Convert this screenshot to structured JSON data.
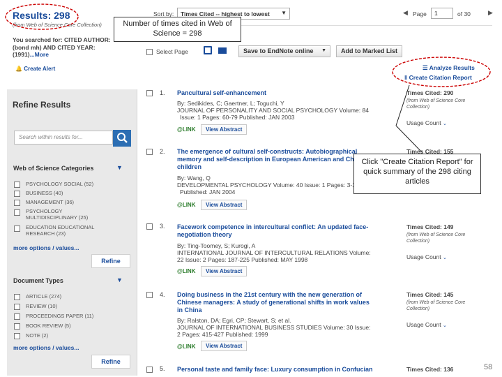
{
  "header": {
    "results_title": "Results: 298",
    "results_source": "(from Web of Science Core Collection)",
    "searched_for": "You searched for: CITED AUTHOR: (bond mh) AND CITED YEAR: (1991)",
    "more_link": "...More",
    "create_alert": "Create Alert"
  },
  "toolbar": {
    "sort_label": "Sort by:",
    "sort_value": "Times Cited -- highest to lowest",
    "page_label": "Page",
    "page_value": "1",
    "page_total": "of 30",
    "select_page": "Select Page",
    "save_endnote": "Save to EndNote online",
    "add_marked": "Add to Marked List",
    "analyze_results": "Analyze Results",
    "create_citation_report": "Create Citation Report"
  },
  "sidebar": {
    "refine_title": "Refine Results",
    "search_placeholder": "Search within results for...",
    "wos_categories_title": "Web of Science Categories",
    "categories": [
      "PSYCHOLOGY SOCIAL (52)",
      "BUSINESS (40)",
      "MANAGEMENT (36)",
      "PSYCHOLOGY MULTIDISCIPLINARY (25)",
      "EDUCATION EDUCATIONAL RESEARCH (23)"
    ],
    "more_options_1": "more options / values...",
    "refine_button_1": "Refine",
    "document_types_title": "Document Types",
    "doc_types": [
      "ARTICLE (274)",
      "REVIEW (10)",
      "PROCEEDINGS PAPER (11)",
      "BOOK REVIEW (5)",
      "NOTE (2)"
    ],
    "more_options_2": "more options / values...",
    "refine_button_2": "Refine"
  },
  "records": [
    {
      "num": "1.",
      "title": "Pancultural self-enhancement",
      "authors": "By: Sedikides, C; Gaertner, L; Toguchi, Y",
      "journal": "JOURNAL OF PERSONALITY AND SOCIAL PSYCHOLOGY   Volume: 84",
      "details": "Issue: 1   Pages: 60-79   Published: JAN 2003",
      "times_cited": "Times Cited: 290",
      "cited_source": "(from Web of Science Core Collection)",
      "usage": "Usage Count",
      "view_abstract": "View Abstract"
    },
    {
      "num": "2.",
      "title_l1": "The emergence of cultural self-constructs: Autobiographical",
      "title_l2": "memory and self-description in European American and Chinese",
      "title_l3": "children",
      "authors": "By: Wang, Q",
      "journal": "DEVELOPMENTAL PSYCHOLOGY   Volume: 40   Issue: 1   Pages: 3-15",
      "details": "Published: JAN 2004",
      "times_cited": "Times Cited: 155",
      "view_abstract": "View Abstract"
    },
    {
      "num": "3.",
      "title_l1": "Facework competence in intercultural conflict: An updated face-",
      "title_l2": "negotiation theory",
      "authors": "By: Ting-Toomey, S; Kurogi, A",
      "journal": "INTERNATIONAL JOURNAL OF INTERCULTURAL RELATIONS   Volume:",
      "details": "22   Issue: 2   Pages: 187-225   Published: MAY 1998",
      "times_cited": "Times Cited: 149",
      "cited_source": "(from Web of Science Core Collection)",
      "usage": "Usage Count",
      "view_abstract": "View Abstract"
    },
    {
      "num": "4.",
      "title_l1": "Doing business in the 21st century with the new generation of",
      "title_l2": "Chinese managers: A study of generational shifts in work values",
      "title_l3": "in China",
      "authors": "By: Ralston, DA; Egri, CP; Stewart, S; et al.",
      "journal": "JOURNAL OF INTERNATIONAL BUSINESS STUDIES   Volume: 30   Issue:",
      "details": "2   Pages: 415-427   Published: 1999",
      "times_cited": "Times Cited: 145",
      "cited_source": "(from Web of Science Core Collection)",
      "usage": "Usage Count",
      "view_abstract": "View Abstract"
    },
    {
      "num": "5.",
      "title": "Personal taste and family face: Luxury consumption in Confucian",
      "times_cited": "Times Cited: 136"
    }
  ],
  "link_logo": "LINK",
  "callouts": {
    "times_cited_note": "Number of times cited in Web of Science = 298",
    "citation_report_note": "Click \"Create Citation Report\" for quick summary of the 298 citing articles"
  },
  "slide_number": "58",
  "colors": {
    "link": "#1a4c9b",
    "sidebar_bg": "#e9e9e9",
    "search_btn": "#2c6eb3",
    "annotation": "#cc0000"
  }
}
